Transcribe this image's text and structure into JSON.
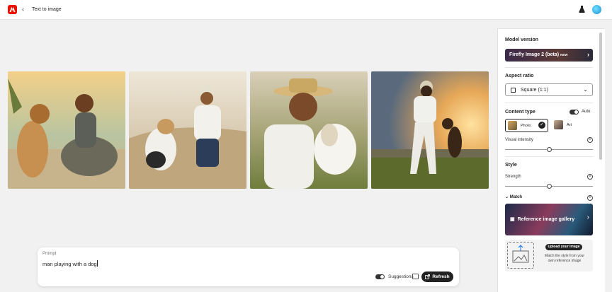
{
  "header": {
    "back_icon": "chevron-left-icon",
    "title": "Text to image"
  },
  "images": [
    {
      "alt_icon": "generated-image",
      "colors": [
        "#e9c07a",
        "#8aa1b0"
      ]
    },
    {
      "alt_icon": "generated-image",
      "colors": [
        "#d6c8b0",
        "#9c8a6a"
      ]
    },
    {
      "alt_icon": "generated-image",
      "colors": [
        "#c8b690",
        "#6b7a3c"
      ]
    },
    {
      "alt_icon": "generated-image",
      "colors": [
        "#f0b060",
        "#4a5a2a"
      ]
    }
  ],
  "prompt": {
    "label": "Prompt",
    "value": "man playing with a dog",
    "suggestions_label": "Suggestions",
    "refresh_label": "Refresh"
  },
  "panel": {
    "model_version_heading": "Model version",
    "model_name": "Firefly Image 2 (beta)",
    "model_badge": "NEW",
    "aspect_ratio_heading": "Aspect ratio",
    "aspect_ratio_value": "Square (1:1)",
    "content_type_heading": "Content type",
    "auto_label": "Auto",
    "content_types": [
      {
        "label": "Photo"
      },
      {
        "label": "Art"
      }
    ],
    "visual_intensity_label": "Visual intensity",
    "visual_intensity_level": 0.5,
    "style_heading": "Style",
    "strength_label": "Strength",
    "strength_level": 0.5,
    "match_label": "Match",
    "gallery_label": "Reference image gallery",
    "upload_button": "Upload your image",
    "upload_desc": "Match the style from your own reference image"
  }
}
